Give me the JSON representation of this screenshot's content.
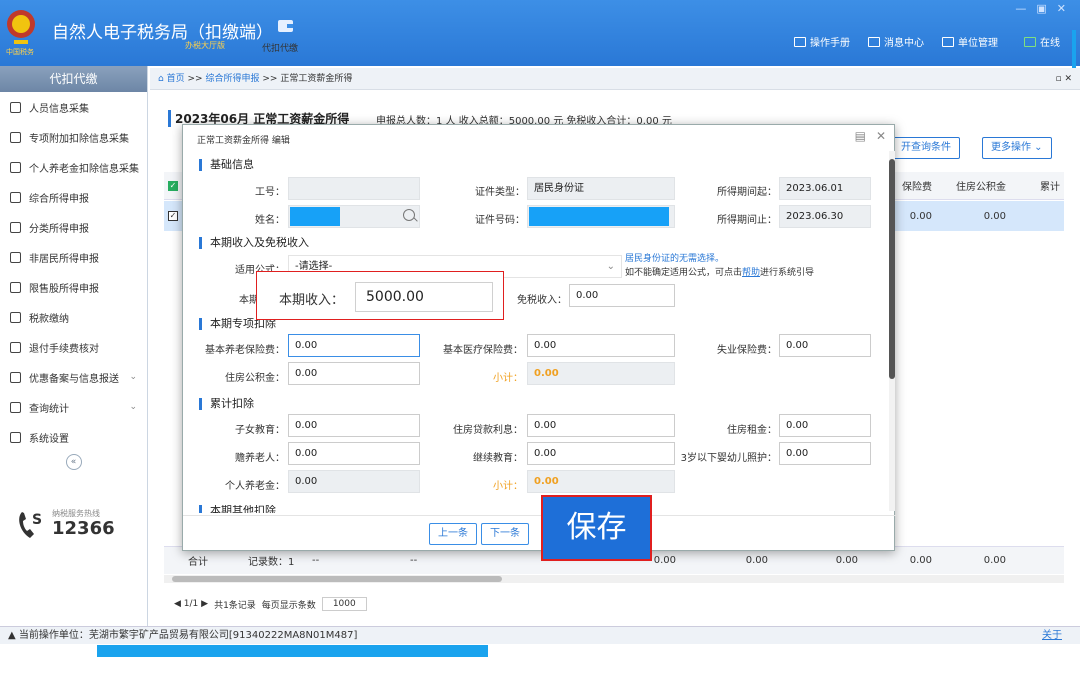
{
  "header": {
    "title": "自然人电子税务局（扣缴端）",
    "subtitle": "办税大厅版",
    "nav_tile": "代扣代缴",
    "links": [
      "操作手册",
      "消息中心",
      "单位管理",
      "在线"
    ],
    "window_controls": [
      "—",
      "▣",
      "✕"
    ]
  },
  "sidebar": {
    "header": "代扣代缴",
    "items": [
      {
        "label": "人员信息采集",
        "icon": "person-icon"
      },
      {
        "label": "专项附加扣除信息采集",
        "icon": "list-icon"
      },
      {
        "label": "个人养老金扣除信息采集",
        "icon": "doc-icon"
      },
      {
        "label": "综合所得申报",
        "icon": "layers-icon"
      },
      {
        "label": "分类所得申报",
        "icon": "clock-icon"
      },
      {
        "label": "非居民所得申报",
        "icon": "user-icon"
      },
      {
        "label": "限售股所得申报",
        "icon": "bar-icon"
      },
      {
        "label": "税款缴纳",
        "icon": "wallet-icon"
      },
      {
        "label": "退付手续费核对",
        "icon": "receipt-icon"
      },
      {
        "label": "优惠备案与信息报送",
        "icon": "file-icon",
        "chevron": "⌄"
      },
      {
        "label": "查询统计",
        "icon": "query-icon",
        "chevron": "⌄"
      },
      {
        "label": "系统设置",
        "icon": "gear-icon"
      }
    ],
    "collapse": "«",
    "hotline_label": "纳税服务热线",
    "hotline_number": "12366"
  },
  "breadcrumb": {
    "home": "首页",
    "sep1": ">>",
    "level1": "综合所得申报",
    "sep2": ">>",
    "current": "正常工资薪金所得",
    "controls": "▫ ✕"
  },
  "page": {
    "title": "2023年06月 正常工资薪金所得",
    "summary": "申报总人数：1 人   收入总额：5000.00 元   免税收入合计：0.00 元",
    "open_query_button": "开查询条件",
    "more_button": "更多操作 ⌄",
    "grid_headers": [
      "保险费",
      "住房公积金",
      "累计"
    ],
    "row_values": [
      "0.00",
      "0.00"
    ],
    "footer": {
      "total_label": "合计",
      "record_count": "记录数：1",
      "dash1": "--",
      "dash2": "--",
      "values": [
        "0.00",
        "0.00",
        "0.00",
        "0.00",
        "0.00"
      ]
    },
    "pager": {
      "nav": "◀ 1/1 ▶",
      "total": "共1条记录",
      "page_size_label": "每页显示条数",
      "page_size": "1000"
    }
  },
  "statusbar": {
    "text": "当前操作单位：芜湖市繁宇矿产品贸易有限公司[91340222MA8N01M487]",
    "about": "关于"
  },
  "modal": {
    "title": "正常工资薪金所得 编辑",
    "sections": {
      "basic": "基础信息",
      "income": "本期收入及免税收入",
      "special": "本期专项扣除",
      "cumulative": "累计扣除",
      "other": "本期其他扣除"
    },
    "basic": {
      "emp_no_label": "工号：",
      "emp_no": "",
      "name_label": "姓名：",
      "id_type_label": "证件类型：",
      "id_type": "居民身份证",
      "id_no_label": "证件号码：",
      "period_start_label": "所得期间起：",
      "period_start": "2023.06.01",
      "period_end_label": "所得期间止：",
      "period_end": "2023.06.30"
    },
    "income": {
      "formula_label": "适用公式：",
      "formula_value": "-请选择-",
      "hint_blue": "居民身份证的无需选择。",
      "hint_pre": "如不能确定适用公式，可点击",
      "hint_link": "帮助",
      "hint_post": "进行系统引导",
      "current_income_label_partial": "本期",
      "exempt_label": "免税收入：",
      "exempt_value": "0.00"
    },
    "special": {
      "pension_label": "基本养老保险费：",
      "pension": "0.00",
      "medical_label": "基本医疗保险费：",
      "medical": "0.00",
      "unemployment_label": "失业保险费：",
      "unemployment": "0.00",
      "housing_fund_label": "住房公积金：",
      "housing_fund": "0.00",
      "subtotal_label": "小计：",
      "subtotal": "0.00"
    },
    "cumulative": {
      "children_label": "子女教育：",
      "children": "0.00",
      "mortgage_label": "住房贷款利息：",
      "mortgage": "0.00",
      "rent_label": "住房租金：",
      "rent": "0.00",
      "elderly_label": "赡养老人：",
      "elderly": "0.00",
      "continuing_label": "继续教育：",
      "continuing": "0.00",
      "infant_label": "3岁以下婴幼儿照护：",
      "infant": "0.00",
      "pension_personal_label": "个人养老金：",
      "pension_personal": "0.00",
      "subtotal_label": "小计：",
      "subtotal": "0.00"
    },
    "footer": {
      "prev": "上一条",
      "next": "下一条"
    }
  },
  "callouts": {
    "income_label": "本期收入：",
    "income_value": "5000.00",
    "save": "保存"
  },
  "colors": {
    "primary": "#2a78d6",
    "highlight": "#e01f1f",
    "mask": "#17a1f7",
    "subtotal": "#f0a020"
  }
}
